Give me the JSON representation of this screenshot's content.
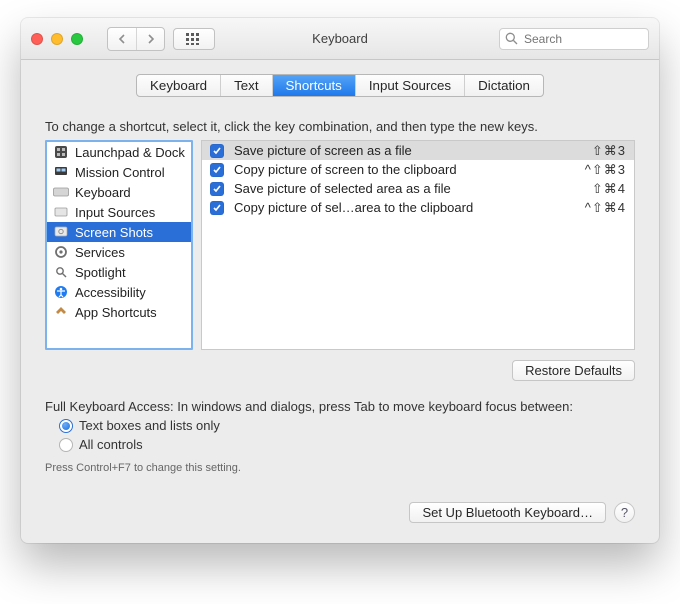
{
  "window": {
    "title": "Keyboard",
    "search_placeholder": "Search"
  },
  "tabs": [
    {
      "label": "Keyboard"
    },
    {
      "label": "Text"
    },
    {
      "label": "Shortcuts"
    },
    {
      "label": "Input Sources"
    },
    {
      "label": "Dictation"
    }
  ],
  "instruction": "To change a shortcut, select it, click the key combination, and then type the new keys.",
  "categories": [
    {
      "label": "Launchpad & Dock"
    },
    {
      "label": "Mission Control"
    },
    {
      "label": "Keyboard"
    },
    {
      "label": "Input Sources"
    },
    {
      "label": "Screen Shots"
    },
    {
      "label": "Services"
    },
    {
      "label": "Spotlight"
    },
    {
      "label": "Accessibility"
    },
    {
      "label": "App Shortcuts"
    }
  ],
  "shortcuts": [
    {
      "label": "Save picture of screen as a file",
      "keys": "⇧⌘3"
    },
    {
      "label": "Copy picture of screen to the clipboard",
      "keys": "^⇧⌘3"
    },
    {
      "label": "Save picture of selected area as a file",
      "keys": "⇧⌘4"
    },
    {
      "label": "Copy picture of sel…area to the clipboard",
      "keys": "^⇧⌘4"
    }
  ],
  "restore_label": "Restore Defaults",
  "access": {
    "heading": "Full Keyboard Access: In windows and dialogs, press Tab to move keyboard focus between:",
    "opt1": "Text boxes and lists only",
    "opt2": "All controls",
    "hint": "Press Control+F7 to change this setting."
  },
  "footer": {
    "bluetooth_label": "Set Up Bluetooth Keyboard…",
    "help": "?"
  }
}
